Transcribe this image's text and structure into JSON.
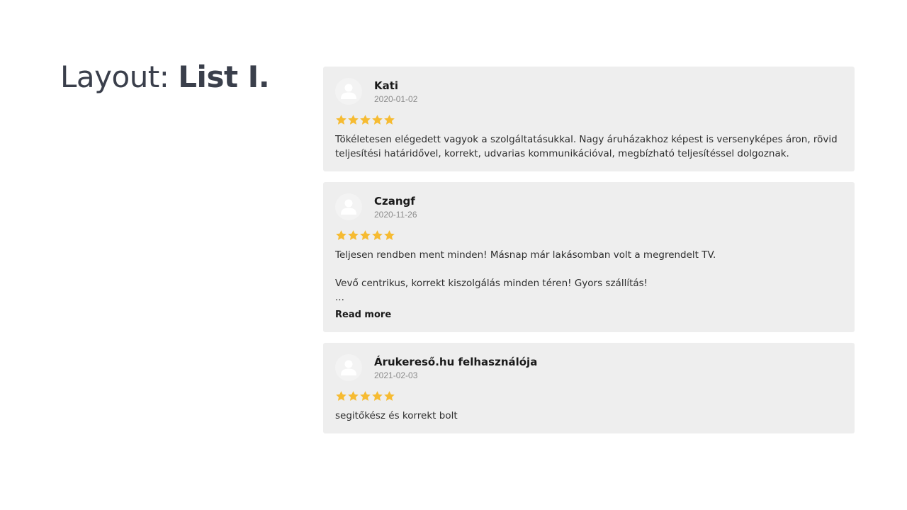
{
  "page": {
    "title_prefix": "Layout: ",
    "title_strong": "List I."
  },
  "colors": {
    "star": "#f6bb32",
    "card_background": "#eeeeee",
    "title": "#3a3f4b"
  },
  "reviews": [
    {
      "author": "Kati",
      "date": "2020-01-02",
      "rating": 5,
      "text": "Tökéletesen elégedett vagyok a szolgáltatásukkal. Nagy áruházakhoz képest is versenyképes áron, rövid teljesítési határidővel, korrekt, udvarias kommunikációval, megbízható teljesítéssel dolgoznak.",
      "avatar_icon": "user-icon"
    },
    {
      "author": "Czangf",
      "date": "2020-11-26",
      "rating": 5,
      "text": "Teljesen rendben ment minden! Másnap már lakásomban volt a megrendelt TV.\n\nVevő centrikus, korrekt kiszolgálás minden téren! Gyors szállítás!\n...",
      "read_more": "Read more",
      "avatar_icon": "user-icon"
    },
    {
      "author": "Árukereső.hu felhasználója",
      "date": "2021-02-03",
      "rating": 5,
      "text": "segitőkész és korrekt bolt",
      "avatar_icon": "user-icon"
    }
  ]
}
